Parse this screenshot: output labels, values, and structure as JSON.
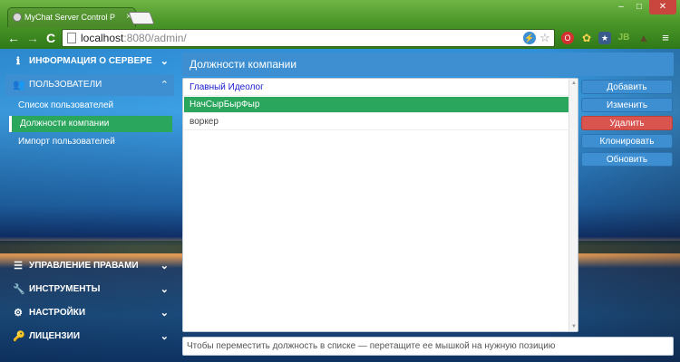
{
  "browser": {
    "tab_title": "MyChat Server Control P",
    "tab_close": "×",
    "url_host": "localhost",
    "url_path": ":8080/admin/",
    "back": "←",
    "forward": "→",
    "reload": "C",
    "window_min": "–",
    "window_max": "□",
    "window_close": "✕",
    "extensions": [
      "opera-icon",
      "star-icon",
      "badge-icon",
      "puzzle-icon",
      "gear-icon",
      "menu-icon"
    ]
  },
  "sidebar": {
    "sections_top": [
      {
        "label": "ИНФОРМАЦИЯ О СЕРВЕРЕ",
        "icon": "info-icon",
        "chevron": "⌄"
      },
      {
        "label": "ПОЛЬЗОВАТЕЛИ",
        "icon": "users-icon",
        "chevron": "⌃"
      }
    ],
    "sub_items": [
      {
        "label": "Список пользователей"
      },
      {
        "label": "Должности компании"
      },
      {
        "label": "Импорт пользователей"
      }
    ],
    "sections_bottom": [
      {
        "label": "УПРАВЛЕНИЕ ПРАВАМИ",
        "icon": "list-icon",
        "chevron": "⌄"
      },
      {
        "label": "ИНСТРУМЕНТЫ",
        "icon": "wrench-icon",
        "chevron": "⌄"
      },
      {
        "label": "НАСТРОЙКИ",
        "icon": "cogs-icon",
        "chevron": "⌄"
      },
      {
        "label": "ЛИЦЕНЗИИ",
        "icon": "key-icon",
        "chevron": "⌄"
      }
    ]
  },
  "main": {
    "title": "Должности компании",
    "positions": [
      {
        "label": "Главный Идеолог"
      },
      {
        "label": "НачСырБырФыр"
      },
      {
        "label": "воркер"
      }
    ],
    "selected_index": 1,
    "buttons": {
      "add": "Добавить",
      "edit": "Изменить",
      "delete": "Удалить",
      "clone": "Клонировать",
      "refresh": "Обновить"
    },
    "hint": "Чтобы переместить должность в списке — перетащите ее мышкой на нужную позицию"
  },
  "colors": {
    "accent": "#3d8fd1",
    "selected": "#2aa65d",
    "danger": "#d9534f"
  }
}
